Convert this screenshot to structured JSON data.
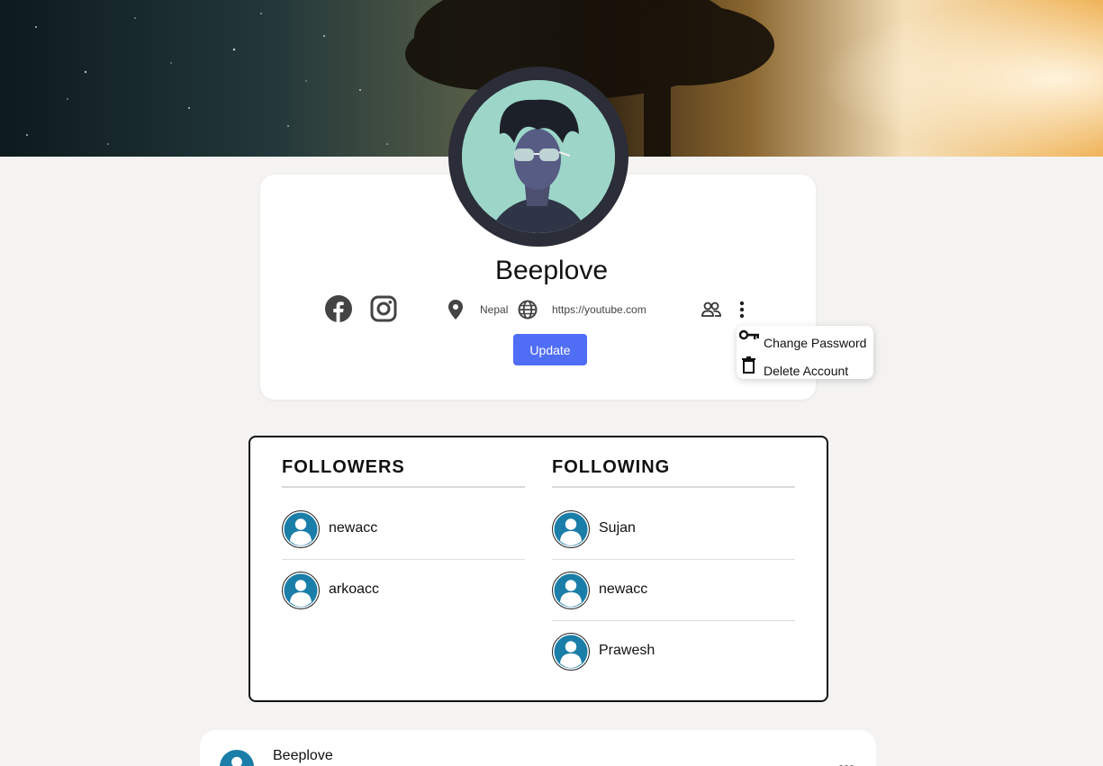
{
  "profile": {
    "name": "Beeplove",
    "location": "Nepal",
    "website": "https://youtube.com",
    "update_label": "Update"
  },
  "menu": {
    "items": [
      {
        "label": "Change Password",
        "icon": "key-icon"
      },
      {
        "label": "Delete Account",
        "icon": "trash-icon"
      }
    ]
  },
  "followers": {
    "title": "FOLLOWERS",
    "users": [
      "newacc",
      "arkoacc"
    ]
  },
  "following": {
    "title": "FOLLOWING",
    "users": [
      "Sujan",
      "newacc",
      "Prawesh"
    ]
  },
  "post": {
    "author": "Beeplove"
  },
  "icons": [
    "facebook-icon",
    "instagram-icon",
    "location-pin-icon",
    "globe-icon",
    "people-icon",
    "more-vertical-icon",
    "more-horizontal-icon",
    "key-icon",
    "trash-icon",
    "user-avatar-icon"
  ],
  "colors": {
    "accent": "#4f6df5",
    "avatar_blue": "#1a7ea8",
    "background": "#f4f3f1"
  }
}
